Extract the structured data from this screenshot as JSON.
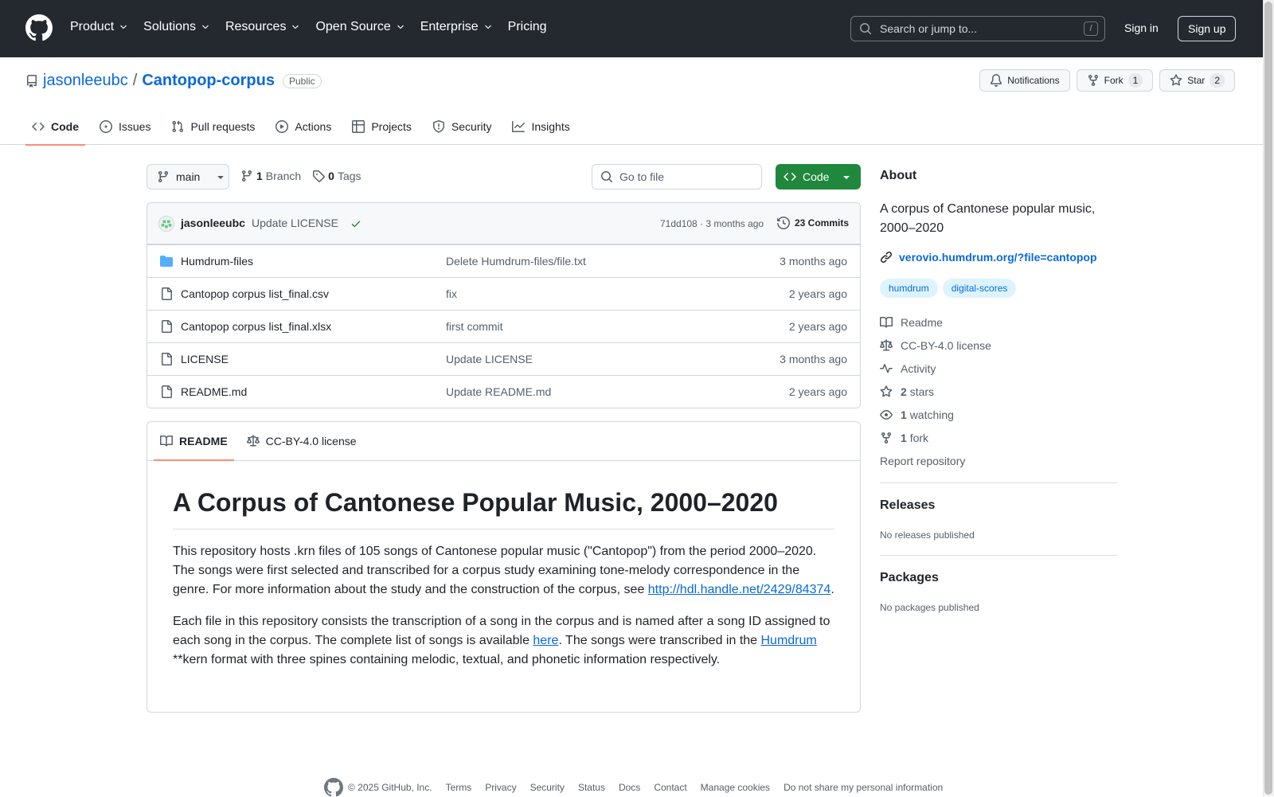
{
  "header": {
    "nav": [
      "Product",
      "Solutions",
      "Resources",
      "Open Source",
      "Enterprise",
      "Pricing"
    ],
    "nav_has_dropdown": [
      true,
      true,
      true,
      true,
      true,
      false
    ],
    "search_placeholder": "Search or jump to...",
    "search_shortcut": "/",
    "sign_in": "Sign in",
    "sign_up": "Sign up"
  },
  "repo": {
    "owner": "jasonleeubc",
    "separator": "/",
    "name": "Cantopop-corpus",
    "visibility": "Public",
    "notifications_label": "Notifications",
    "fork_label": "Fork",
    "fork_count": "1",
    "star_label": "Star",
    "star_count": "2",
    "tabs": [
      {
        "label": "Code",
        "icon": "code-icon",
        "active": true
      },
      {
        "label": "Issues",
        "icon": "issue-icon",
        "active": false
      },
      {
        "label": "Pull requests",
        "icon": "pull-request-icon",
        "active": false
      },
      {
        "label": "Actions",
        "icon": "play-icon",
        "active": false
      },
      {
        "label": "Projects",
        "icon": "table-icon",
        "active": false
      },
      {
        "label": "Security",
        "icon": "shield-icon",
        "active": false
      },
      {
        "label": "Insights",
        "icon": "graph-icon",
        "active": false
      }
    ]
  },
  "toolbar": {
    "branch": "main",
    "branch_count": "1",
    "branch_label": "Branch",
    "tag_count": "0",
    "tag_label": "Tags",
    "goto_placeholder": "Go to file",
    "code_label": "Code"
  },
  "commit": {
    "author": "jasonleeubc",
    "message": "Update LICENSE",
    "hash_time": "71dd108 · 3 months ago",
    "commits_label": "23 Commits"
  },
  "files": [
    {
      "name": "Humdrum-files",
      "type": "folder",
      "message": "Delete Humdrum-files/file.txt",
      "age": "3 months ago"
    },
    {
      "name": "Cantopop corpus list_final.csv",
      "type": "file",
      "message": "fix",
      "age": "2 years ago"
    },
    {
      "name": "Cantopop corpus list_final.xlsx",
      "type": "file",
      "message": "first commit",
      "age": "2 years ago"
    },
    {
      "name": "LICENSE",
      "type": "file",
      "message": "Update LICENSE",
      "age": "3 months ago"
    },
    {
      "name": "README.md",
      "type": "file",
      "message": "Update README.md",
      "age": "2 years ago"
    }
  ],
  "readme": {
    "tab_readme": "README",
    "tab_license": "CC-BY-4.0 license",
    "title": "A Corpus of Cantonese Popular Music, 2000–2020",
    "p1_text": "This repository hosts .krn files of 105 songs of Cantonese popular music (\"Cantopop\") from the period 2000–2020. The songs were first selected and transcribed for a corpus study examining tone-melody correspondence in the genre. For more information about the study and the construction of the corpus, see ",
    "p1_link": "http://hdl.handle.net/2429/84374",
    "p1_end": ".",
    "p2_a": "Each file in this repository consists the transcription of a song in the corpus and is named after a song ID assigned to each song in the corpus. The complete list of songs is available ",
    "p2_link1": "here",
    "p2_b": ". The songs were transcribed in the ",
    "p2_link2": "Humdrum",
    "p2_c": " **kern format with three spines containing melodic, textual, and phonetic information respectively."
  },
  "about": {
    "heading": "About",
    "description": "A corpus of Cantonese popular music, 2000–2020",
    "homepage": "verovio.humdrum.org/?file=cantopop",
    "topics": [
      "humdrum",
      "digital-scores"
    ],
    "readme": "Readme",
    "license": "CC-BY-4.0 license",
    "activity": "Activity",
    "stars_count": "2",
    "stars_label": "stars",
    "watching_count": "1",
    "watching_label": "watching",
    "forks_count": "1",
    "forks_label": "fork",
    "report": "Report repository"
  },
  "releases": {
    "heading": "Releases",
    "empty": "No releases published"
  },
  "packages": {
    "heading": "Packages",
    "empty": "No packages published"
  },
  "footer": {
    "copyright": "© 2025 GitHub, Inc.",
    "links": [
      "Terms",
      "Privacy",
      "Security",
      "Status",
      "Docs",
      "Contact",
      "Manage cookies",
      "Do not share my personal information"
    ]
  },
  "colors": {
    "header_bg": "#24292f",
    "link": "#0969da",
    "code_button": "#1f883d",
    "active_tab_underline": "#fd8c73",
    "topic_bg": "#ddf4ff"
  }
}
